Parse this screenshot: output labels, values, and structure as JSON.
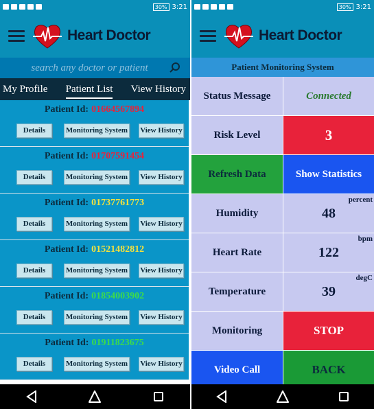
{
  "status_bar": {
    "battery": "30%",
    "time": "3:21"
  },
  "app": {
    "title": "Heart Doctor"
  },
  "left_screen": {
    "search": {
      "placeholder": "search any doctor or patient"
    },
    "tabs": [
      {
        "label": "My Profile"
      },
      {
        "label": "Patient List",
        "active": true
      },
      {
        "label": "View History"
      }
    ],
    "patient_id_label": "Patient Id:",
    "buttons": {
      "details": "Details",
      "monitoring": "Monitoring System",
      "history": "View History"
    },
    "patients": [
      {
        "id": "01664567894",
        "id_color": "#e8223a"
      },
      {
        "id": "01707591454",
        "id_color": "#e8223a"
      },
      {
        "id": "01737761773",
        "id_color": "#f5e23c"
      },
      {
        "id": "01521482812",
        "id_color": "#f5e23c"
      },
      {
        "id": "01854003902",
        "id_color": "#3ddb4a"
      },
      {
        "id": "01911823675",
        "id_color": "#3ddb4a"
      }
    ]
  },
  "right_screen": {
    "header": "Patient Monitoring System",
    "rows": {
      "status": {
        "label": "Status Message",
        "value": "Connected"
      },
      "risk": {
        "label": "Risk Level",
        "value": "3"
      },
      "actions": {
        "refresh": "Refresh Data",
        "stats": "Show Statistics"
      },
      "humidity": {
        "label": "Humidity",
        "value": "48",
        "unit": "percent"
      },
      "heart_rate": {
        "label": "Heart Rate",
        "value": "122",
        "unit": "bpm"
      },
      "temperature": {
        "label": "Temperature",
        "value": "39",
        "unit": "degC"
      },
      "monitoring": {
        "label": "Monitoring",
        "button": "STOP"
      },
      "bottom": {
        "video_call": "Video Call",
        "back": "BACK"
      }
    }
  },
  "icons": {
    "menu": "hamburger-icon",
    "logo": "heart-pulse-icon",
    "search": "search-icon",
    "nav": [
      "back-icon",
      "home-icon",
      "recents-icon"
    ]
  }
}
